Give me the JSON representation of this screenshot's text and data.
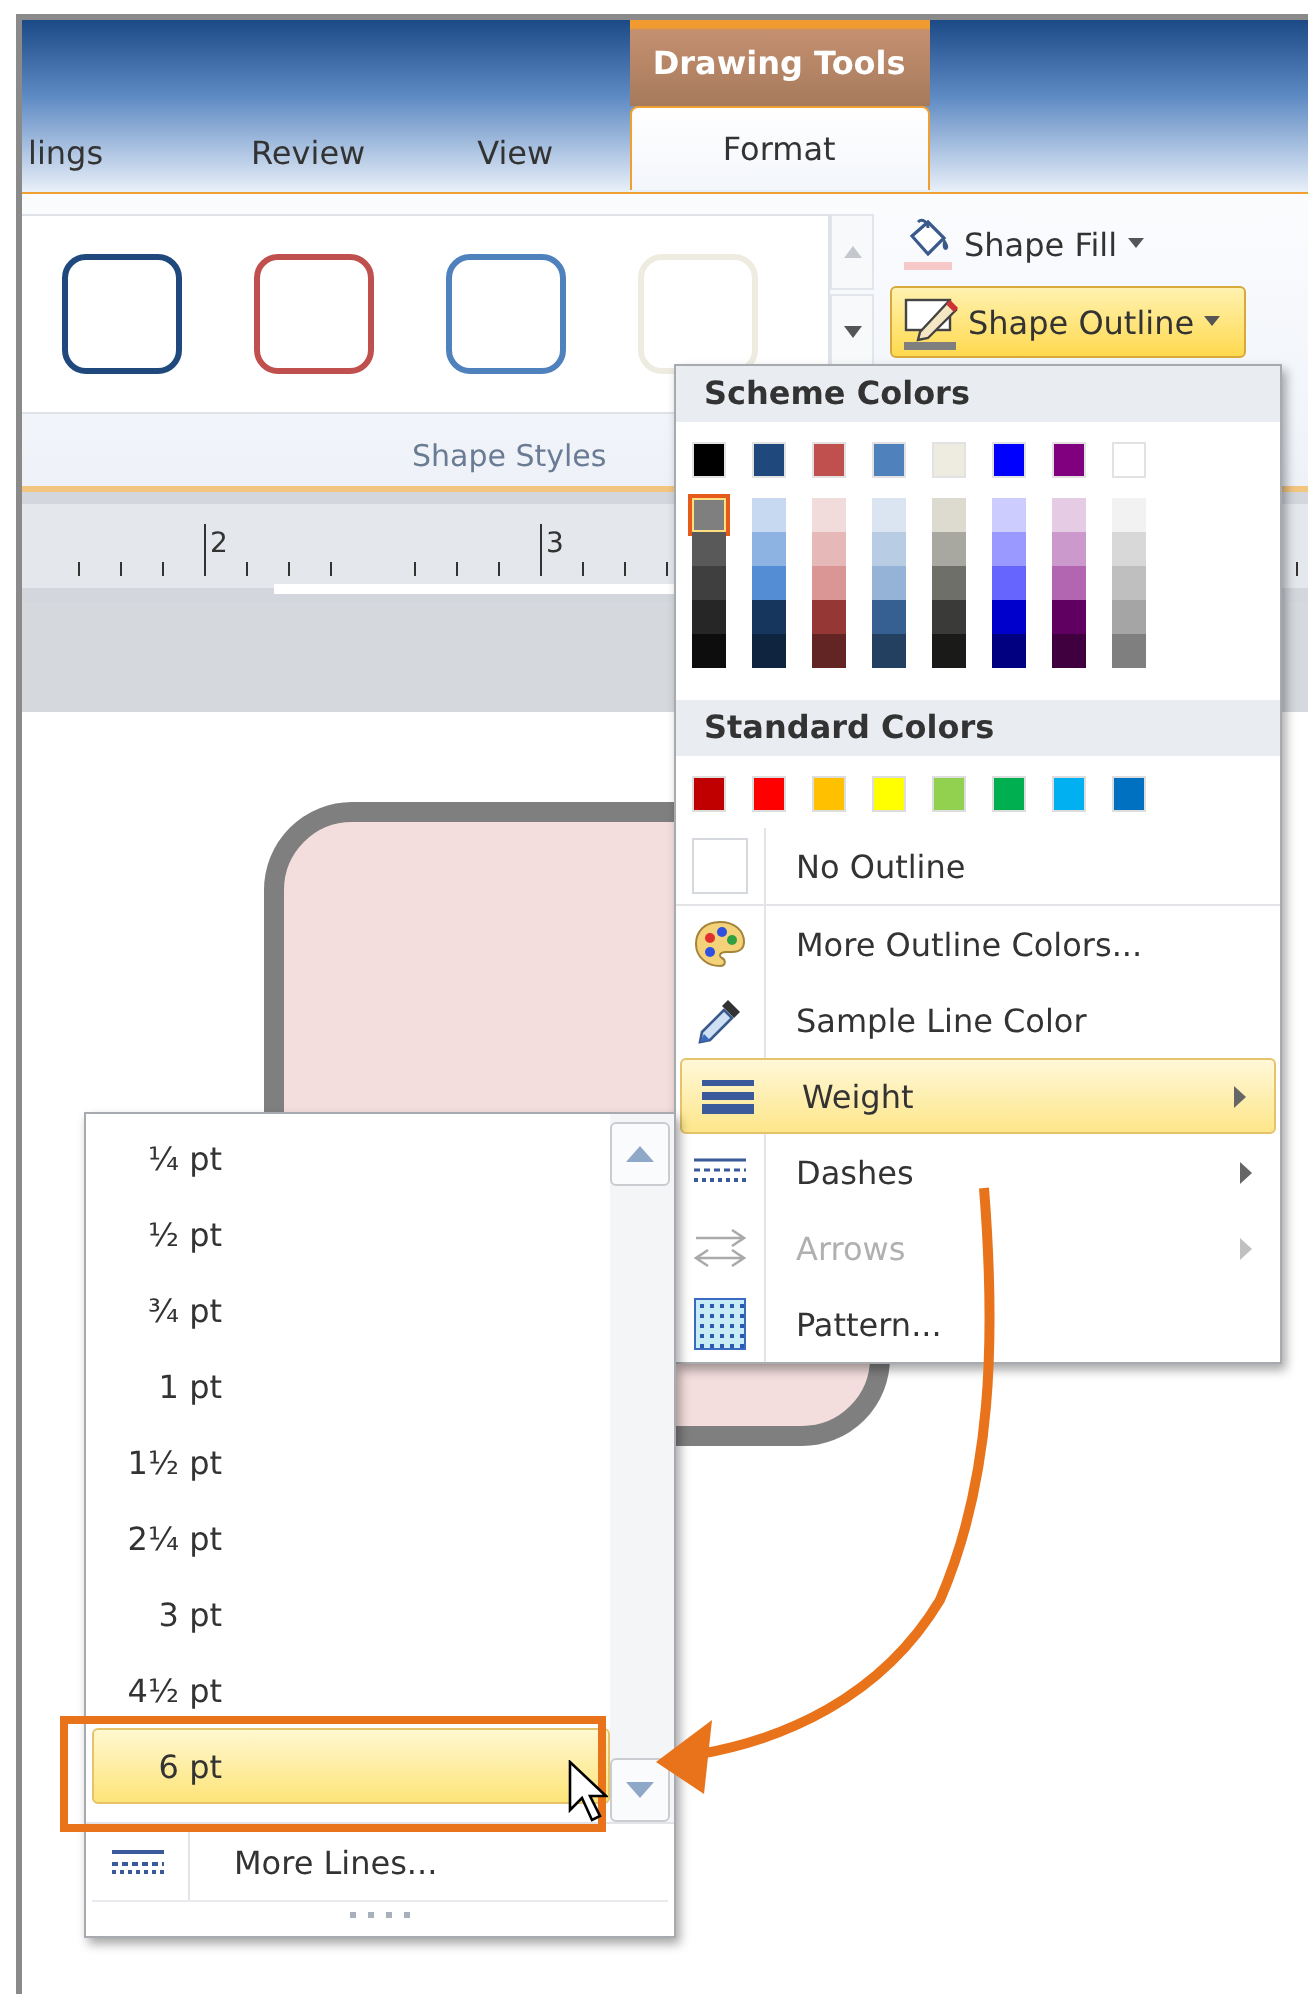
{
  "ribbon": {
    "contextual_header": "Drawing Tools",
    "tabs": [
      {
        "label": "lings",
        "selected": false
      },
      {
        "label": "Review",
        "selected": false
      },
      {
        "label": "View",
        "selected": false
      },
      {
        "label": "Format",
        "selected": true
      }
    ],
    "gallery": [
      {
        "color": "#1f497d"
      },
      {
        "color": "#c0504d"
      },
      {
        "color": "#4f81bd"
      },
      {
        "color": "#eeece1"
      }
    ],
    "commands": [
      {
        "kind": "fill",
        "label": "Shape Fill",
        "selected": false
      },
      {
        "kind": "outline",
        "label": "Shape Outline",
        "selected": true
      }
    ],
    "group_label": "Shape Styles"
  },
  "ruler": {
    "labels": [
      "2",
      "3"
    ]
  },
  "outline_menu": {
    "scheme_title": "Scheme Colors",
    "scheme_columns": [
      {
        "color": "#000000",
        "shades": [
          {
            "color": "#7f7f7f",
            "selected": true
          },
          {
            "color": "#595959",
            "selected": false
          },
          {
            "color": "#3f3f3f",
            "selected": false
          },
          {
            "color": "#262626",
            "selected": false
          },
          {
            "color": "#0d0d0d",
            "selected": false
          }
        ]
      },
      {
        "color": "#1f497d",
        "shades": [
          {
            "color": "#c6d9f1",
            "selected": false
          },
          {
            "color": "#8db3e2",
            "selected": false
          },
          {
            "color": "#548dd4",
            "selected": false
          },
          {
            "color": "#17365d",
            "selected": false
          },
          {
            "color": "#0f243e",
            "selected": false
          }
        ]
      },
      {
        "color": "#c0504d",
        "shades": [
          {
            "color": "#f2dcdb",
            "selected": false
          },
          {
            "color": "#e6b9b8",
            "selected": false
          },
          {
            "color": "#d99694",
            "selected": false
          },
          {
            "color": "#953735",
            "selected": false
          },
          {
            "color": "#632523",
            "selected": false
          }
        ]
      },
      {
        "color": "#4f81bd",
        "shades": [
          {
            "color": "#dbe5f1",
            "selected": false
          },
          {
            "color": "#b8cce4",
            "selected": false
          },
          {
            "color": "#95b3d7",
            "selected": false
          },
          {
            "color": "#366092",
            "selected": false
          },
          {
            "color": "#244061",
            "selected": false
          }
        ]
      },
      {
        "color": "#eeece1",
        "shades": [
          {
            "color": "#dddad0",
            "selected": false
          },
          {
            "color": "#a8a8a0",
            "selected": false
          },
          {
            "color": "#6f6f6a",
            "selected": false
          },
          {
            "color": "#3a3a38",
            "selected": false
          },
          {
            "color": "#1a1a18",
            "selected": false
          }
        ]
      },
      {
        "color": "#0000ff",
        "shades": [
          {
            "color": "#ccccff",
            "selected": false
          },
          {
            "color": "#9999ff",
            "selected": false
          },
          {
            "color": "#6666ff",
            "selected": false
          },
          {
            "color": "#0000cc",
            "selected": false
          },
          {
            "color": "#000080",
            "selected": false
          }
        ]
      },
      {
        "color": "#800080",
        "shades": [
          {
            "color": "#e5cce4",
            "selected": false
          },
          {
            "color": "#cc99cc",
            "selected": false
          },
          {
            "color": "#b266b2",
            "selected": false
          },
          {
            "color": "#600060",
            "selected": false
          },
          {
            "color": "#400040",
            "selected": false
          }
        ]
      },
      {
        "color": "#ffffff",
        "shades": [
          {
            "color": "#f2f2f2",
            "selected": false
          },
          {
            "color": "#d8d8d8",
            "selected": false
          },
          {
            "color": "#bfbfbf",
            "selected": false
          },
          {
            "color": "#a5a5a5",
            "selected": false
          },
          {
            "color": "#7f7f7f",
            "selected": false
          }
        ]
      }
    ],
    "standard_title": "Standard Colors",
    "standard_colors": [
      {
        "color": "#c00000"
      },
      {
        "color": "#ff0000"
      },
      {
        "color": "#ffc000"
      },
      {
        "color": "#ffff00"
      },
      {
        "color": "#92d050"
      },
      {
        "color": "#00b050"
      },
      {
        "color": "#00b0f0"
      },
      {
        "color": "#0070c0"
      }
    ],
    "items": [
      {
        "kind": "no_outline",
        "label": "No Outline",
        "submenu": false,
        "disabled": false,
        "selected": false
      },
      {
        "kind": "palette",
        "label": "More Outline Colors...",
        "submenu": false,
        "disabled": false,
        "selected": false
      },
      {
        "kind": "eyedropper",
        "label": "Sample Line Color",
        "submenu": false,
        "disabled": false,
        "selected": false
      },
      {
        "kind": "weight",
        "label": "Weight",
        "submenu": true,
        "disabled": false,
        "selected": true
      },
      {
        "kind": "dashes",
        "label": "Dashes",
        "submenu": true,
        "disabled": false,
        "selected": false
      },
      {
        "kind": "arrows",
        "label": "Arrows",
        "submenu": true,
        "disabled": true,
        "selected": false
      },
      {
        "kind": "pattern",
        "label": "Pattern...",
        "submenu": false,
        "disabled": false,
        "selected": false
      }
    ]
  },
  "weight_menu": {
    "items": [
      {
        "label": "¼ pt",
        "selected": false
      },
      {
        "label": "½ pt",
        "selected": false
      },
      {
        "label": "¾ pt",
        "selected": false
      },
      {
        "label": "1 pt",
        "selected": false
      },
      {
        "label": "1½ pt",
        "selected": false
      },
      {
        "label": "2¼ pt",
        "selected": false
      },
      {
        "label": "3 pt",
        "selected": false
      },
      {
        "label": "4½ pt",
        "selected": false
      },
      {
        "label": "6 pt",
        "selected": true
      }
    ],
    "more_lines": "More Lines..."
  }
}
